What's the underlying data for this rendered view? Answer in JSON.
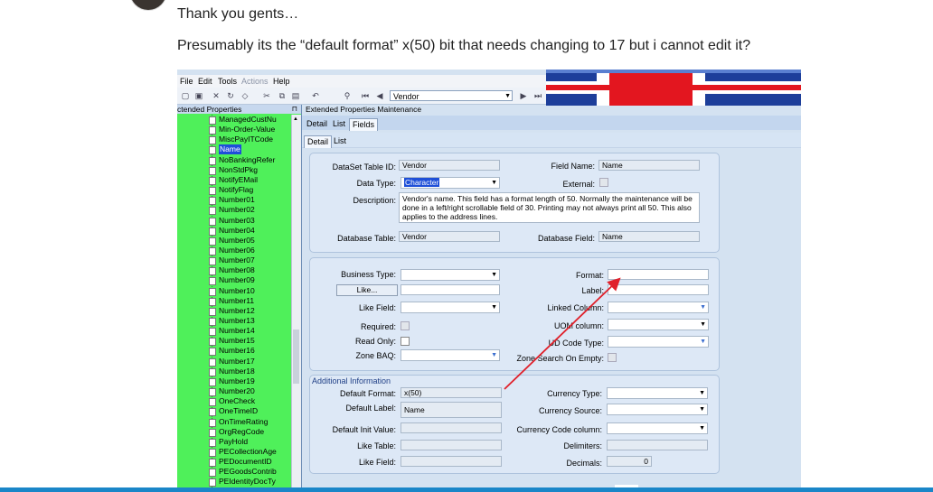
{
  "post": {
    "line1": "Thank you gents…",
    "line2": "Presumably its the “default format” x(50) bit that needs changing to 17 but i cannot edit it?"
  },
  "app": {
    "menu": [
      "File",
      "Edit",
      "Tools",
      "Actions",
      "Help"
    ],
    "toolbar_combo_value": "Vendor",
    "left_pane_title": "ctended Properties",
    "left_items": [
      "ManagedCustNu",
      "Min-Order-Value",
      "MiscPayITCode",
      "Name",
      "NoBankingRefer",
      "NonStdPkg",
      "NotifyEMail",
      "NotifyFlag",
      "Number01",
      "Number02",
      "Number03",
      "Number04",
      "Number05",
      "Number06",
      "Number07",
      "Number08",
      "Number09",
      "Number10",
      "Number11",
      "Number12",
      "Number13",
      "Number14",
      "Number15",
      "Number16",
      "Number17",
      "Number18",
      "Number19",
      "Number20",
      "OneCheck",
      "OneTimeID",
      "OnTimeRating",
      "OrgRegCode",
      "PayHold",
      "PECollectionAge",
      "PEDocumentID",
      "PEGoodsContrib",
      "PEIdentityDocTy"
    ],
    "selected_item": "Name",
    "right_title": "Extended Properties Maintenance",
    "tabs_top": [
      "Detail",
      "List",
      "Fields"
    ],
    "tabs_sub": [
      "Detail",
      "List"
    ],
    "group1": {
      "dataset_label": "DataSet Table ID:",
      "dataset_value": "Vendor",
      "field_name_label": "Field Name:",
      "field_name_value": "Name",
      "data_type_label": "Data Type:",
      "data_type_value": "Character",
      "external_label": "External:",
      "description_label": "Description:",
      "description_value": "Vendor's name.  This field has a format length of 50. Normally the maintenance will be done in a left/right scrollable field of 30. Printing may not always print all 50. This also applies to the address lines.",
      "db_table_label": "Database Table:",
      "db_table_value": "Vendor",
      "db_field_label": "Database Field:",
      "db_field_value": "Name"
    },
    "group2": {
      "business_type_label": "Business Type:",
      "like_button": "Like...",
      "like_field_label": "Like Field:",
      "required_label": "Required:",
      "read_only_label": "Read Only:",
      "zone_baq_label": "Zone BAQ:",
      "format_label": "Format:",
      "label_label": "Label:",
      "linked_column_label": "Linked Column:",
      "uom_column_label": "UOM column:",
      "ud_code_type_label": "UD Code Type:",
      "zone_search_label": "Zone Search On Empty:"
    },
    "group3": {
      "title": "Additional Information",
      "default_format_label": "Default Format:",
      "default_format_value": "x(50)",
      "default_label_label": "Default Label:",
      "default_label_value": "Name",
      "default_init_label": "Default Init Value:",
      "like_table_label": "Like Table:",
      "like_field_label": "Like Field:",
      "currency_type_label": "Currency Type:",
      "currency_source_label": "Currency Source:",
      "currency_code_label": "Currency Code column:",
      "delimiters_label": "Delimiters:",
      "decimals_label": "Decimals:",
      "decimals_value": "0"
    },
    "colors": {
      "left_pane": "#4ff05a",
      "selection": "#1e4fd8",
      "arrow": "#e0202a"
    }
  }
}
